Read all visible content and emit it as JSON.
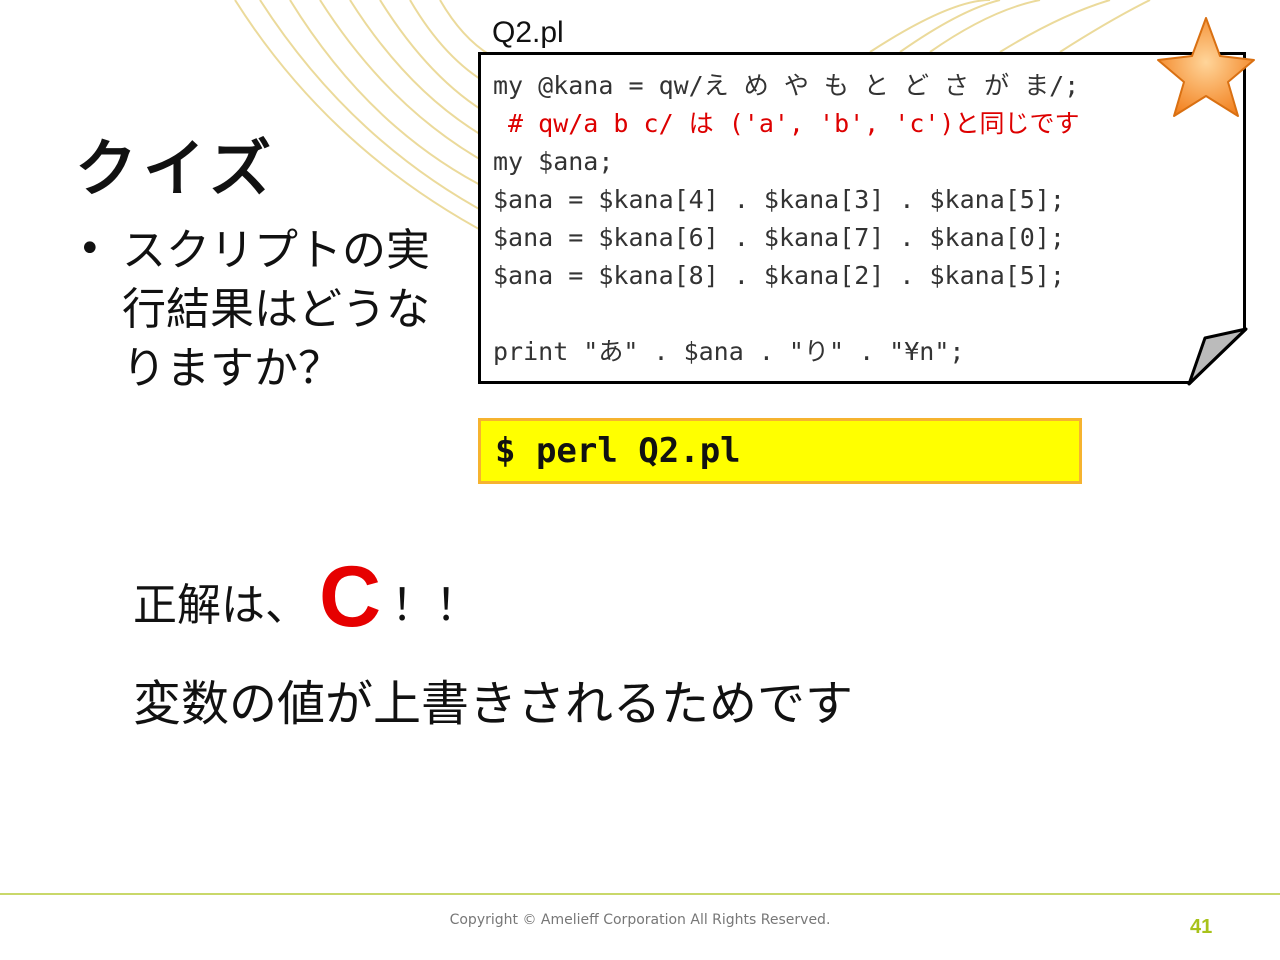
{
  "slide": {
    "title": "クイズ",
    "bullet_marker": "•",
    "bullet": "スクリプトの実行結果はどうなりますか？",
    "filename": "Q2.pl",
    "code_lines": [
      {
        "type": "code",
        "text": "my @kana = qw/え め や も と ど さ が ま/;"
      },
      {
        "type": "comment",
        "text": " # qw/a b c/ は ('a', 'b', 'c')と同じです"
      },
      {
        "type": "code",
        "text": "my $ana;"
      },
      {
        "type": "code",
        "text": "$ana = $kana[4] . $kana[3] . $kana[5];"
      },
      {
        "type": "code",
        "text": "$ana = $kana[6] . $kana[7] . $kana[0];"
      },
      {
        "type": "code",
        "text": "$ana = $kana[8] . $kana[2] . $kana[5];"
      },
      {
        "type": "code",
        "text": ""
      },
      {
        "type": "code",
        "text": "print \"あ\" . $ana . \"り\" . \"¥n\";"
      }
    ],
    "command": "$ perl Q2.pl",
    "answer_prefix": "正解は、",
    "answer_letter": "C",
    "answer_suffix": "！！",
    "explanation": "変数の値が上書きされるためです",
    "copyright": "Copyright © Amelieff Corporation All Rights Reserved.",
    "page_number": "41"
  },
  "colors": {
    "accent_red": "#e60000",
    "command_bg": "#ffff00",
    "command_border": "#f6b32f",
    "star": "#f7962b",
    "footer_green": "#a8c21a"
  },
  "icons": {
    "badge": "star-icon",
    "page_curl": "page-curl-icon"
  }
}
